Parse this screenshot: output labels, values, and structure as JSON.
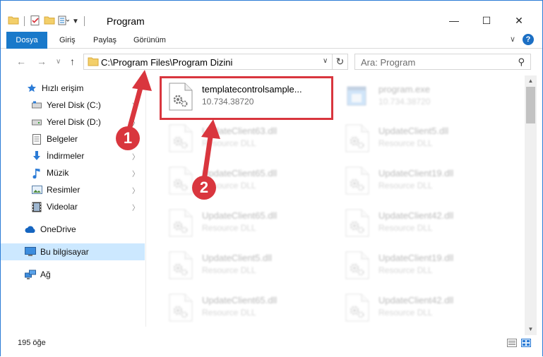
{
  "window": {
    "title": "Program",
    "controls": {
      "minimize": "—",
      "maximize": "☐",
      "close": "✕"
    }
  },
  "ribbon": {
    "tabs": [
      "Dosya",
      "Giriş",
      "Paylaş",
      "Görünüm"
    ],
    "help": "?"
  },
  "nav": {
    "address": "C:\\Program Files\\Program Dizini",
    "search_placeholder": "Ara: Program"
  },
  "sidebar": {
    "items": [
      {
        "label": "Hızlı erişim",
        "icon": "star-icon",
        "pinned": false
      },
      {
        "label": "Yerel Disk (C:)",
        "icon": "drive-icon",
        "pinned": true
      },
      {
        "label": "Yerel Disk (D:)",
        "icon": "drive-icon",
        "pinned": true
      },
      {
        "label": "Belgeler",
        "icon": "documents-icon",
        "pinned": true
      },
      {
        "label": "İndirmeler",
        "icon": "download-icon",
        "pinned": true
      },
      {
        "label": "Müzik",
        "icon": "music-icon",
        "pinned": true
      },
      {
        "label": "Resimler",
        "icon": "pictures-icon",
        "pinned": true
      },
      {
        "label": "Videolar",
        "icon": "video-icon",
        "pinned": true
      },
      {
        "label": "OneDrive",
        "icon": "cloud-icon",
        "pinned": false
      },
      {
        "label": "Bu bilgisayar",
        "icon": "computer-icon",
        "pinned": false
      },
      {
        "label": "Ağ",
        "icon": "network-icon",
        "pinned": false
      }
    ]
  },
  "files": [
    {
      "name": "templatecontrolsample...",
      "sub": "10.734.38720",
      "type": "dll",
      "highlight": true
    },
    {
      "name": "program.exe",
      "sub": "10.734.38720",
      "type": "exe",
      "highlight": false
    },
    {
      "name": "UpdateClient63.dll",
      "sub": "Resource DLL",
      "type": "dll",
      "highlight": false
    },
    {
      "name": "UpdateClient5.dll",
      "sub": "Resource DLL",
      "type": "dll",
      "highlight": false
    },
    {
      "name": "UpdateClient65.dll",
      "sub": "Resource DLL",
      "type": "dll",
      "highlight": false
    },
    {
      "name": "UpdateClient19.dll",
      "sub": "Resource DLL",
      "type": "dll",
      "highlight": false
    },
    {
      "name": "UpdateClient65.dll",
      "sub": "Resource DLL",
      "type": "dll",
      "highlight": false
    },
    {
      "name": "UpdateClient42.dll",
      "sub": "Resource DLL",
      "type": "dll",
      "highlight": false
    },
    {
      "name": "UpdateClient5.dll",
      "sub": "Resource DLL",
      "type": "dll",
      "highlight": false
    },
    {
      "name": "UpdateClient19.dll",
      "sub": "Resource DLL",
      "type": "dll",
      "highlight": false
    },
    {
      "name": "UpdateClient65.dll",
      "sub": "Resource DLL",
      "type": "dll",
      "highlight": false
    },
    {
      "name": "UpdateClient42.dll",
      "sub": "Resource DLL",
      "type": "dll",
      "highlight": false
    }
  ],
  "status": {
    "count": "195 öğe"
  },
  "callouts": [
    "1",
    "2"
  ],
  "colors": {
    "accent": "#1979ca",
    "callout": "#d9363e",
    "selection": "#cce8ff"
  }
}
